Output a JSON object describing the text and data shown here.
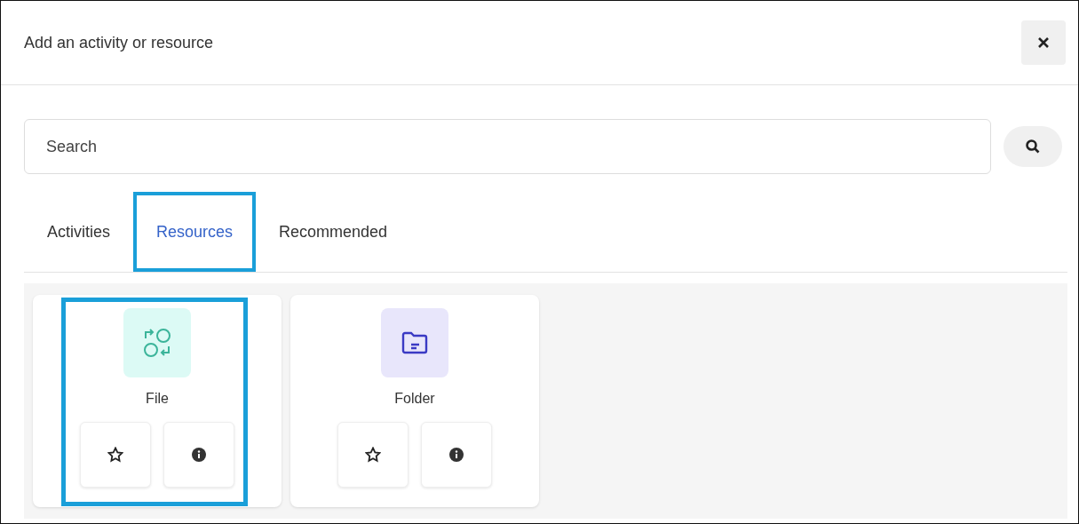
{
  "dialog": {
    "title": "Add an activity or resource"
  },
  "search": {
    "placeholder": "Search"
  },
  "tabs": [
    {
      "label": "Activities",
      "selected": false,
      "highlighted": false
    },
    {
      "label": "Resources",
      "selected": true,
      "highlighted": true
    },
    {
      "label": "Recommended",
      "selected": false,
      "highlighted": false
    }
  ],
  "items": [
    {
      "name": "File",
      "kind": "file",
      "highlighted": true,
      "starred": false
    },
    {
      "name": "Folder",
      "kind": "folder",
      "highlighted": false,
      "starred": false
    }
  ]
}
